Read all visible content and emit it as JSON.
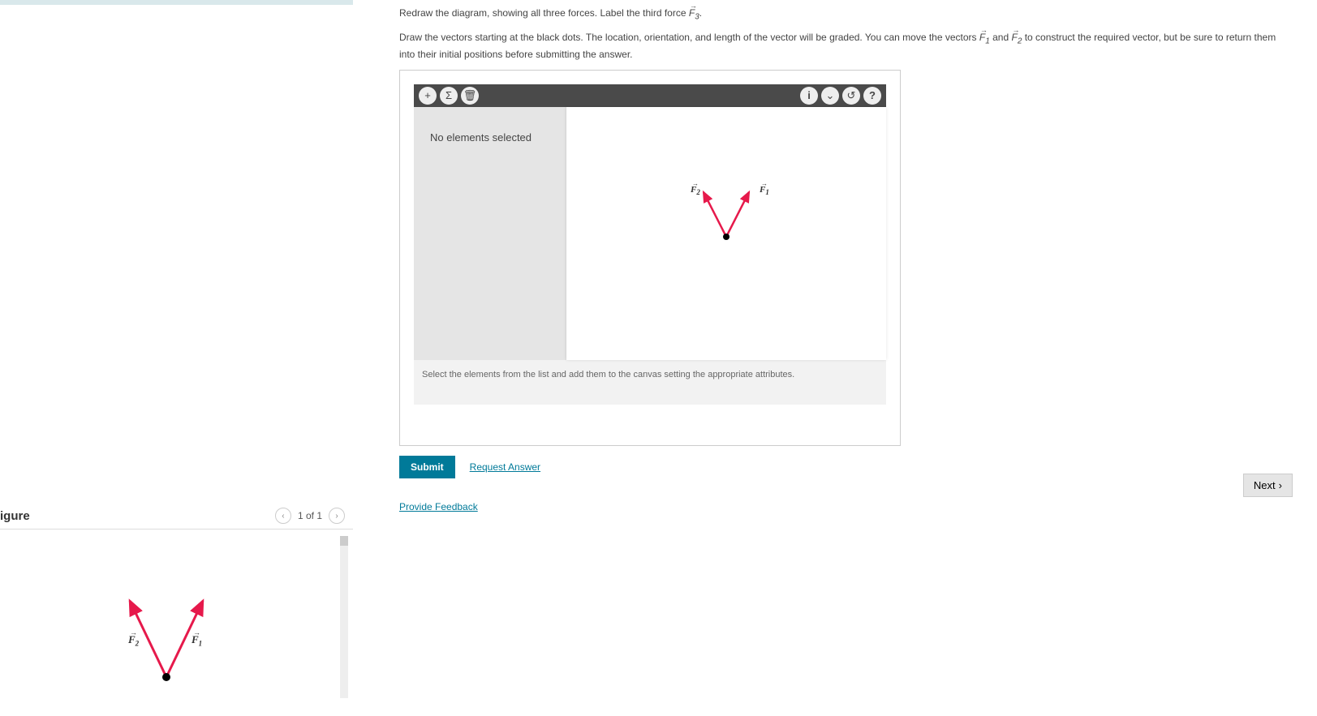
{
  "instructions": {
    "line1_prefix": "Redraw the diagram, showing all three forces. Label the third force ",
    "line1_vec": "F⃗₃",
    "line1_suffix": ".",
    "line2_prefix": "Draw the vectors starting at the black dots. The location, orientation, and length of the vector will be graded. You can move the vectors ",
    "line2_vec1": "F⃗₁",
    "line2_mid": " and ",
    "line2_vec2": "F⃗₂",
    "line2_suffix": " to construct the required vector, but be sure to return them into their initial positions before submitting the answer."
  },
  "workspace": {
    "side_message": "No elements selected",
    "footer_message": "Select the elements from the list and add them to the canvas setting the appropriate attributes.",
    "canvas_labels": {
      "f1": "F⃗₁",
      "f2": "F⃗₂"
    }
  },
  "toolbar": {
    "add": "+",
    "sum": "Σ",
    "delete": "🗑",
    "info": "i",
    "down": "⌄",
    "reset": "↺",
    "help": "?"
  },
  "actions": {
    "submit": "Submit",
    "request": "Request Answer",
    "feedback": "Provide Feedback",
    "next": "Next"
  },
  "figure": {
    "title": "igure",
    "pager": "1 of 1",
    "labels": {
      "f1": "F⃗₁",
      "f2": "F⃗₂"
    }
  }
}
